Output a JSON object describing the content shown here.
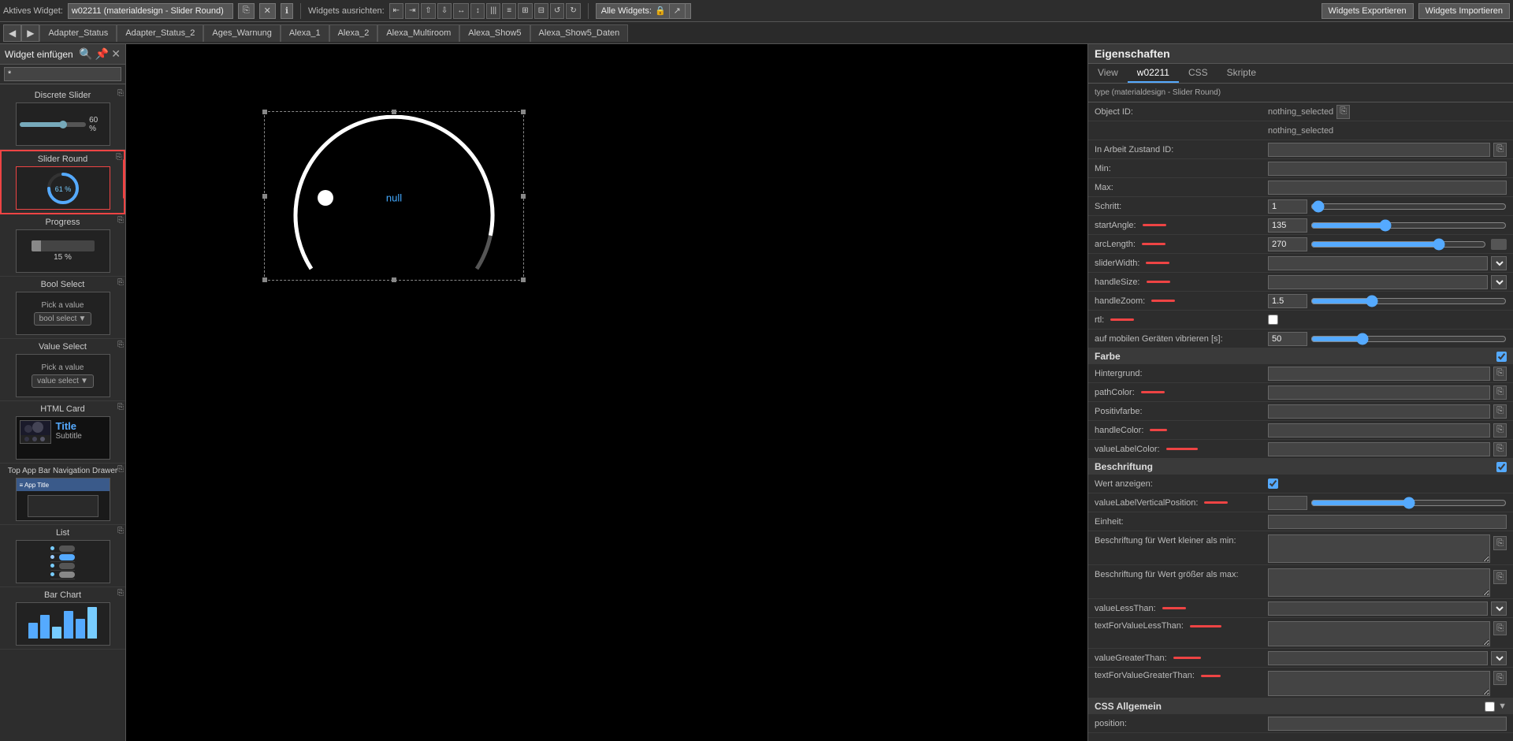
{
  "top_toolbar": {
    "aktives_widget_label": "Aktives Widget:",
    "widget_name": "w02211 (materialdesign - Slider Round)",
    "delete_btn": "✕",
    "info_btn": "ℹ",
    "align_label": "Widgets ausrichten:",
    "align_icons": [
      "⇤",
      "⇥",
      "⇧",
      "⇩",
      "↔",
      "↕",
      "⬛",
      "⬛",
      "⬛",
      "⬛",
      "↺",
      "↻"
    ],
    "alle_widgets_label": "Alle Widgets:",
    "export_btn": "Widgets Exportieren",
    "import_btn": "Widgets Importieren"
  },
  "tab_bar": {
    "nav_back": "◀",
    "nav_fwd": "▶",
    "tabs": [
      {
        "label": "Adapter_Status",
        "active": false
      },
      {
        "label": "Adapter_Status_2",
        "active": false
      },
      {
        "label": "Ages_Warnung",
        "active": false
      },
      {
        "label": "Alexa_1",
        "active": false
      },
      {
        "label": "Alexa_2",
        "active": false
      },
      {
        "label": "Alexa_Multiroom",
        "active": false
      },
      {
        "label": "Alexa_Show5",
        "active": false
      },
      {
        "label": "Alexa_Show5_Daten",
        "active": false
      }
    ]
  },
  "left_sidebar": {
    "title": "Widget einfügen",
    "search_icon": "🔍",
    "pin_icon": "📌",
    "close_icon": "✕",
    "search_placeholder": "*",
    "widgets": [
      {
        "name": "Discrete Slider",
        "value": "60 %"
      },
      {
        "name": "Slider Round",
        "value": "61 %"
      },
      {
        "name": "Progress",
        "value": "15 %"
      },
      {
        "name": "Bool Select",
        "value": "bool select"
      },
      {
        "name": "Value Select",
        "value": "value select"
      },
      {
        "name": "HTML Card",
        "title": "Title",
        "subtitle": "Subtitle"
      },
      {
        "name": "Top App Bar Navigation Drawer",
        "value": ""
      },
      {
        "name": "List",
        "value": ""
      },
      {
        "name": "Bar Chart",
        "value": ""
      }
    ]
  },
  "canvas": {
    "null_text": "null"
  },
  "properties_panel": {
    "title": "Eigenschaften",
    "tabs": [
      "View",
      "w02211",
      "CSS",
      "Skripte"
    ],
    "active_tab": "w02211",
    "fields": {
      "object_id_label": "Object ID:",
      "object_id_value": "nothing_selected",
      "object_id_value2": "nothing_selected",
      "in_arbeit_label": "In Arbeit Zustand ID:",
      "min_label": "Min:",
      "max_label": "Max:",
      "schritt_label": "Schritt:",
      "schritt_value": "1",
      "startAngle_label": "startAngle:",
      "startAngle_value": "135",
      "arcLength_label": "arcLength:",
      "arcLength_value": "270",
      "sliderWidth_label": "sliderWidth:",
      "handleSize_label": "handleSize:",
      "handleZoom_label": "handleZoom:",
      "handleZoom_value": "1.5",
      "rtl_label": "rtl:",
      "vibrate_label": "auf mobilen Geräten vibrieren [s]:",
      "vibrate_value": "50",
      "section_farbe": "Farbe",
      "hintergrund_label": "Hintergrund:",
      "pathColor_label": "pathColor:",
      "positivfarbe_label": "Positivfarbe:",
      "handleColor_label": "handleColor:",
      "valueLabelColor_label": "valueLabelColor:",
      "section_beschriftung": "Beschriftung",
      "wert_anzeigen_label": "Wert anzeigen:",
      "valueLabelVerticalPosition_label": "valueLabelVerticalPosition:",
      "einheit_label": "Einheit:",
      "beschriftung_kleiner_label": "Beschriftung für Wert kleiner als min:",
      "beschriftung_groesser_label": "Beschriftung für Wert größer als max:",
      "valueLessThan_label": "valueLessThan:",
      "textForValueLessThan_label": "textForValueLessThan:",
      "valueGreaterThan_label": "valueGreaterThan:",
      "textForValueGreaterThan_label": "textForValueGreaterThan:",
      "section_css": "CSS Allgemein",
      "position_label": "position:"
    }
  }
}
